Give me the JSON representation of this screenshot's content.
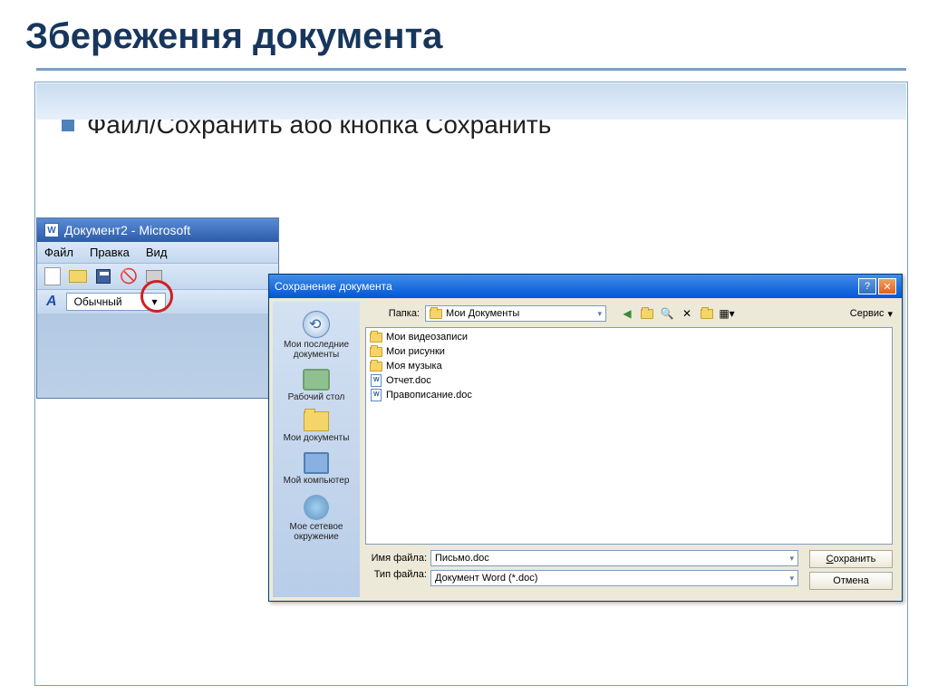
{
  "slide": {
    "title": "Збереження документа",
    "bullet": "Файл/Сохранить  або кнопка Сохранить"
  },
  "word": {
    "title": "Документ2 - Microsoft",
    "menu": {
      "file": "Файл",
      "edit": "Правка",
      "view": "Вид"
    },
    "style": "Обычный",
    "aa": "A"
  },
  "dialog": {
    "title": "Сохранение документа",
    "folder_label": "Папка:",
    "folder_value": "Мои Документы",
    "tools_label": "Сервис",
    "places": {
      "recent": "Мои последние документы",
      "desktop": "Рабочий стол",
      "mydocs": "Мои документы",
      "computer": "Мой компьютер",
      "network": "Мое сетевое окружение"
    },
    "files": {
      "f1": "Мои видеозаписи",
      "f2": "Мои рисунки",
      "f3": "Моя музыка",
      "f4": "Отчет.doc",
      "f5": "Правописание.doc"
    },
    "filename_label": "Имя файла:",
    "filename_value": "Письмо.doc",
    "filetype_label": "Тип файла:",
    "filetype_value": "Документ Word (*.doc)",
    "btn_save": "Сохранить",
    "btn_cancel": "Отмена"
  }
}
